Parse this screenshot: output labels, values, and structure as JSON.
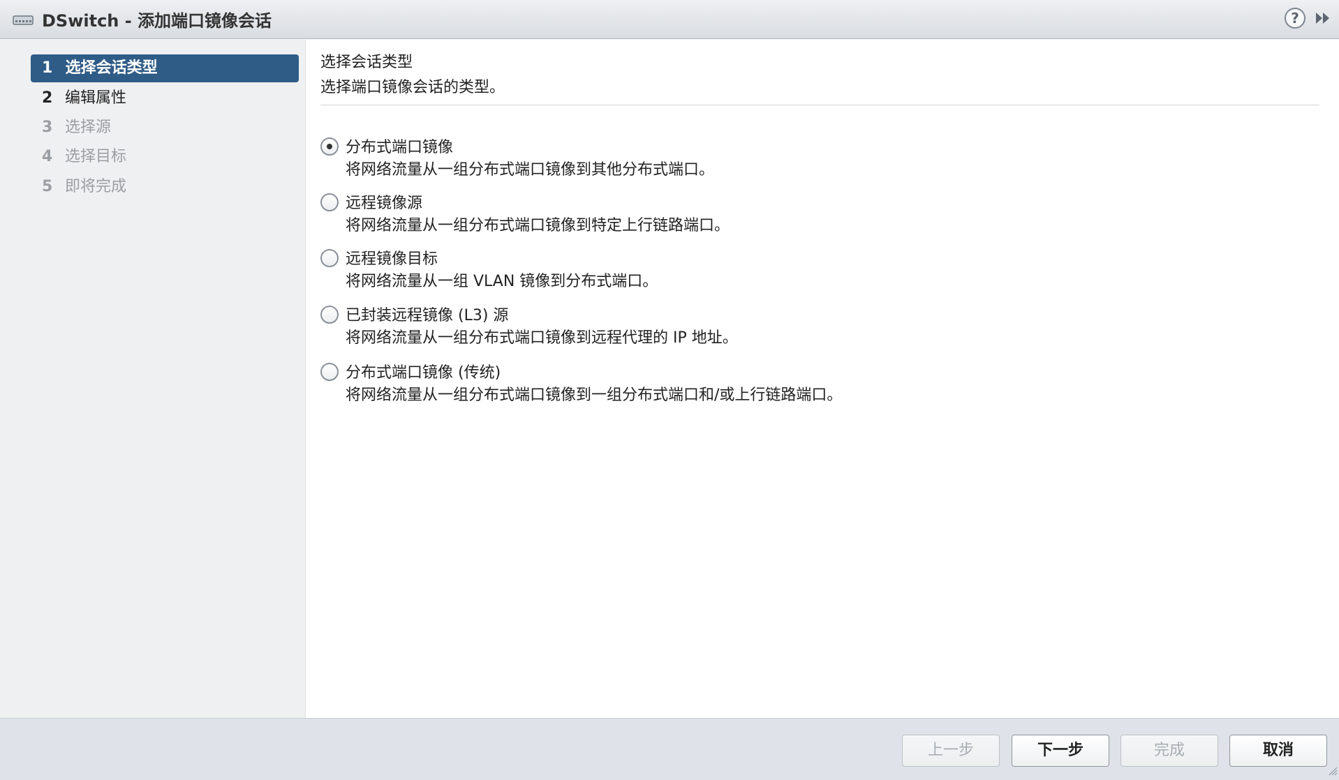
{
  "window": {
    "title": "DSwitch - 添加端口镜像会话",
    "help_label": "?"
  },
  "steps": [
    {
      "num": "1",
      "label": "选择会话类型",
      "state": "active"
    },
    {
      "num": "2",
      "label": "编辑属性",
      "state": "enabled"
    },
    {
      "num": "3",
      "label": "选择源",
      "state": "disabled"
    },
    {
      "num": "4",
      "label": "选择目标",
      "state": "disabled"
    },
    {
      "num": "5",
      "label": "即将完成",
      "state": "disabled"
    }
  ],
  "main": {
    "title": "选择会话类型",
    "subtitle": "选择端口镜像会话的类型。",
    "options": [
      {
        "label": "分布式端口镜像",
        "desc": "将网络流量从一组分布式端口镜像到其他分布式端口。",
        "checked": true
      },
      {
        "label": "远程镜像源",
        "desc": "将网络流量从一组分布式端口镜像到特定上行链路端口。",
        "checked": false
      },
      {
        "label": "远程镜像目标",
        "desc": "将网络流量从一组 VLAN 镜像到分布式端口。",
        "checked": false
      },
      {
        "label": "已封装远程镜像 (L3) 源",
        "desc": "将网络流量从一组分布式端口镜像到远程代理的 IP 地址。",
        "checked": false
      },
      {
        "label": "分布式端口镜像 (传统)",
        "desc": "将网络流量从一组分布式端口镜像到一组分布式端口和/或上行链路端口。",
        "checked": false
      }
    ]
  },
  "footer": {
    "back": "上一步",
    "next": "下一步",
    "finish": "完成",
    "cancel": "取消"
  },
  "colors": {
    "active_step_bg": "#2f5b87",
    "disabled_text": "#9b9fa3"
  }
}
